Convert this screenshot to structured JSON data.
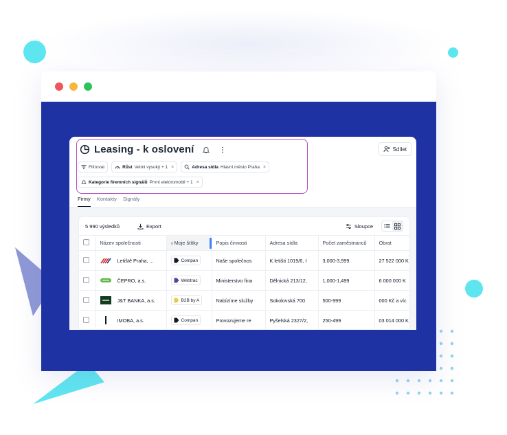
{
  "window": {
    "traffic_lights": [
      "#f0555a",
      "#f5b83d",
      "#2ec25a"
    ]
  },
  "colors": {
    "background_frame": "#1f32a3",
    "highlight_border": "#b04fc4",
    "accent": "#5ee6f0",
    "decor_purple": "#8f98d6"
  },
  "header": {
    "title": "Leasing - k oslovení",
    "title_icon": "pie-chart-icon",
    "bell_icon": "bell-icon",
    "more_icon": "more-vertical-icon",
    "share_label": "Sdílet",
    "share_icon": "user-plus-icon"
  },
  "filters": {
    "filter_label": "Filtrovat",
    "chips": [
      {
        "icon": "growth-icon",
        "name": "Růst",
        "value": "Velmi vysoký + 1"
      },
      {
        "icon": "search-location-icon",
        "name": "Adresa sídla",
        "value": "Hlavní město Praha"
      },
      {
        "icon": "bell-icon",
        "name": "Kategorie firemních signálů",
        "value": "První elektromobil + 1"
      }
    ]
  },
  "tabs": [
    {
      "label": "Firmy",
      "active": true
    },
    {
      "label": "Kontakty",
      "active": false
    },
    {
      "label": "Signály",
      "active": false
    }
  ],
  "toolbar": {
    "results": "5 990 výsledků",
    "export_label": "Export",
    "columns_label": "Sloupce"
  },
  "table": {
    "headers": [
      "Název společnosti",
      "Moje štítky",
      "Popis činnosti",
      "Adresa sídla",
      "Počet zaměstnanců",
      "Obrat"
    ],
    "rows": [
      {
        "company": "Letiště Praha, ...",
        "logo": "letiste",
        "tag": "Compan",
        "tag_color": "#111827",
        "description": "Naše společnos",
        "address": "K letišti 1019/6, I",
        "employees": "3,000-3,999",
        "revenue": "27 522 000 K"
      },
      {
        "company": "ČEPRO, a.s.",
        "logo": "cepro",
        "tag": "Webtrac",
        "tag_color": "#5b3fa0",
        "description": "Ministerstvo fina",
        "address": "Dělnická 213/12,",
        "employees": "1,000-1,499",
        "revenue": "6 000 000 K"
      },
      {
        "company": "J&T BANKA, a.s.",
        "logo": "jt",
        "tag": "B2B by A",
        "tag_color": "#e9c84a",
        "description": "Nabízíme služby",
        "address": "Sokolovská 700",
        "employees": "500-999",
        "revenue": "000 Kč a víc"
      },
      {
        "company": "IMOBA, a.s.",
        "logo": "imoba",
        "tag": "Compan",
        "tag_color": "#111827",
        "description": "Provozujeme re",
        "address": "Pyšelská 2327/2,",
        "employees": "250-499",
        "revenue": "03 014 000 K"
      }
    ]
  }
}
